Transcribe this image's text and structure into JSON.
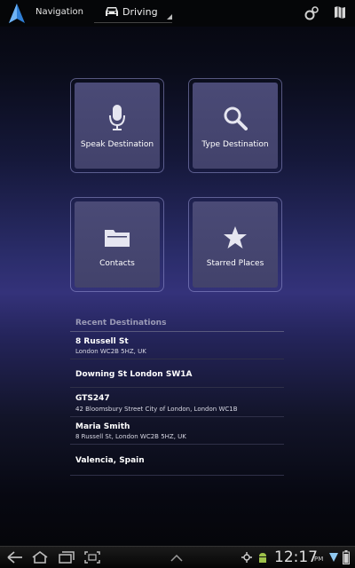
{
  "app": {
    "title": "Navigation",
    "mode": "Driving",
    "accent": "#2f7fd6"
  },
  "actions": {
    "layers_icon": "settings-icon",
    "map_icon": "map-icon"
  },
  "tiles": [
    {
      "label": "Speak Destination",
      "icon": "microphone-icon"
    },
    {
      "label": "Type Destination",
      "icon": "search-icon"
    },
    {
      "label": "Contacts",
      "icon": "folder-icon"
    },
    {
      "label": "Starred Places",
      "icon": "star-icon"
    }
  ],
  "recent": {
    "header": "Recent Destinations",
    "items": [
      {
        "title": "8 Russell St",
        "subtitle": "London WC2B 5HZ, UK"
      },
      {
        "title": "Downing St London SW1A",
        "subtitle": ""
      },
      {
        "title": "GTS247",
        "subtitle": "42 Bloomsbury Street City of London, London WC1B"
      },
      {
        "title": "Maria Smith",
        "subtitle": "8 Russell St, London WC2B 5HZ, UK"
      },
      {
        "title": "Valencia, Spain",
        "subtitle": ""
      }
    ]
  },
  "status": {
    "time": "12:17",
    "ampm": "PM"
  }
}
